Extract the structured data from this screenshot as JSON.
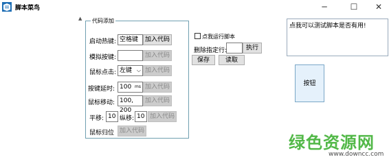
{
  "window": {
    "title": "脚本菜鸟",
    "minimize_glyph": "─",
    "maximize_glyph": "☐",
    "close_glyph": "✕"
  },
  "code_group": {
    "legend": "代码添加",
    "hotkey_label": "启动热键:",
    "hotkey_value": "空格键",
    "hotkey_add": "加入代码",
    "simkey_label": "模拟按键:",
    "simkey_value": "",
    "simkey_add": "加入代码",
    "mouseclick_label": "鼠标点击:",
    "mouseclick_value": "左键",
    "mouseclick_add": "加入代码",
    "delay_label": "按键延时:",
    "delay_value": "100",
    "delay_unit": "ms",
    "delay_add": "加入代码",
    "mousemove_label": "鼠标移动:",
    "mousemove_value": "100, 200",
    "mousemove_add": "加入代码",
    "panx_label": "平移:",
    "panx_value": "10",
    "pany_label": "纵移:",
    "pany_value": "10",
    "pan_add": "加入代码",
    "mousehome_label": "鼠标归位",
    "mousehome_add": "加入代码"
  },
  "right_panel": {
    "run_script_label": "点我运行脚本",
    "delete_line_label": "删除指定行:",
    "delete_line_value": "",
    "execute_button": "执行",
    "save_button": "保存",
    "read_button": "读取"
  },
  "output": {
    "text": "点我可以测试脚本是否有用!"
  },
  "test_button": {
    "label": "按钮"
  },
  "watermark": {
    "main": "绿色资源网",
    "sub": "www.downcc.com"
  }
}
